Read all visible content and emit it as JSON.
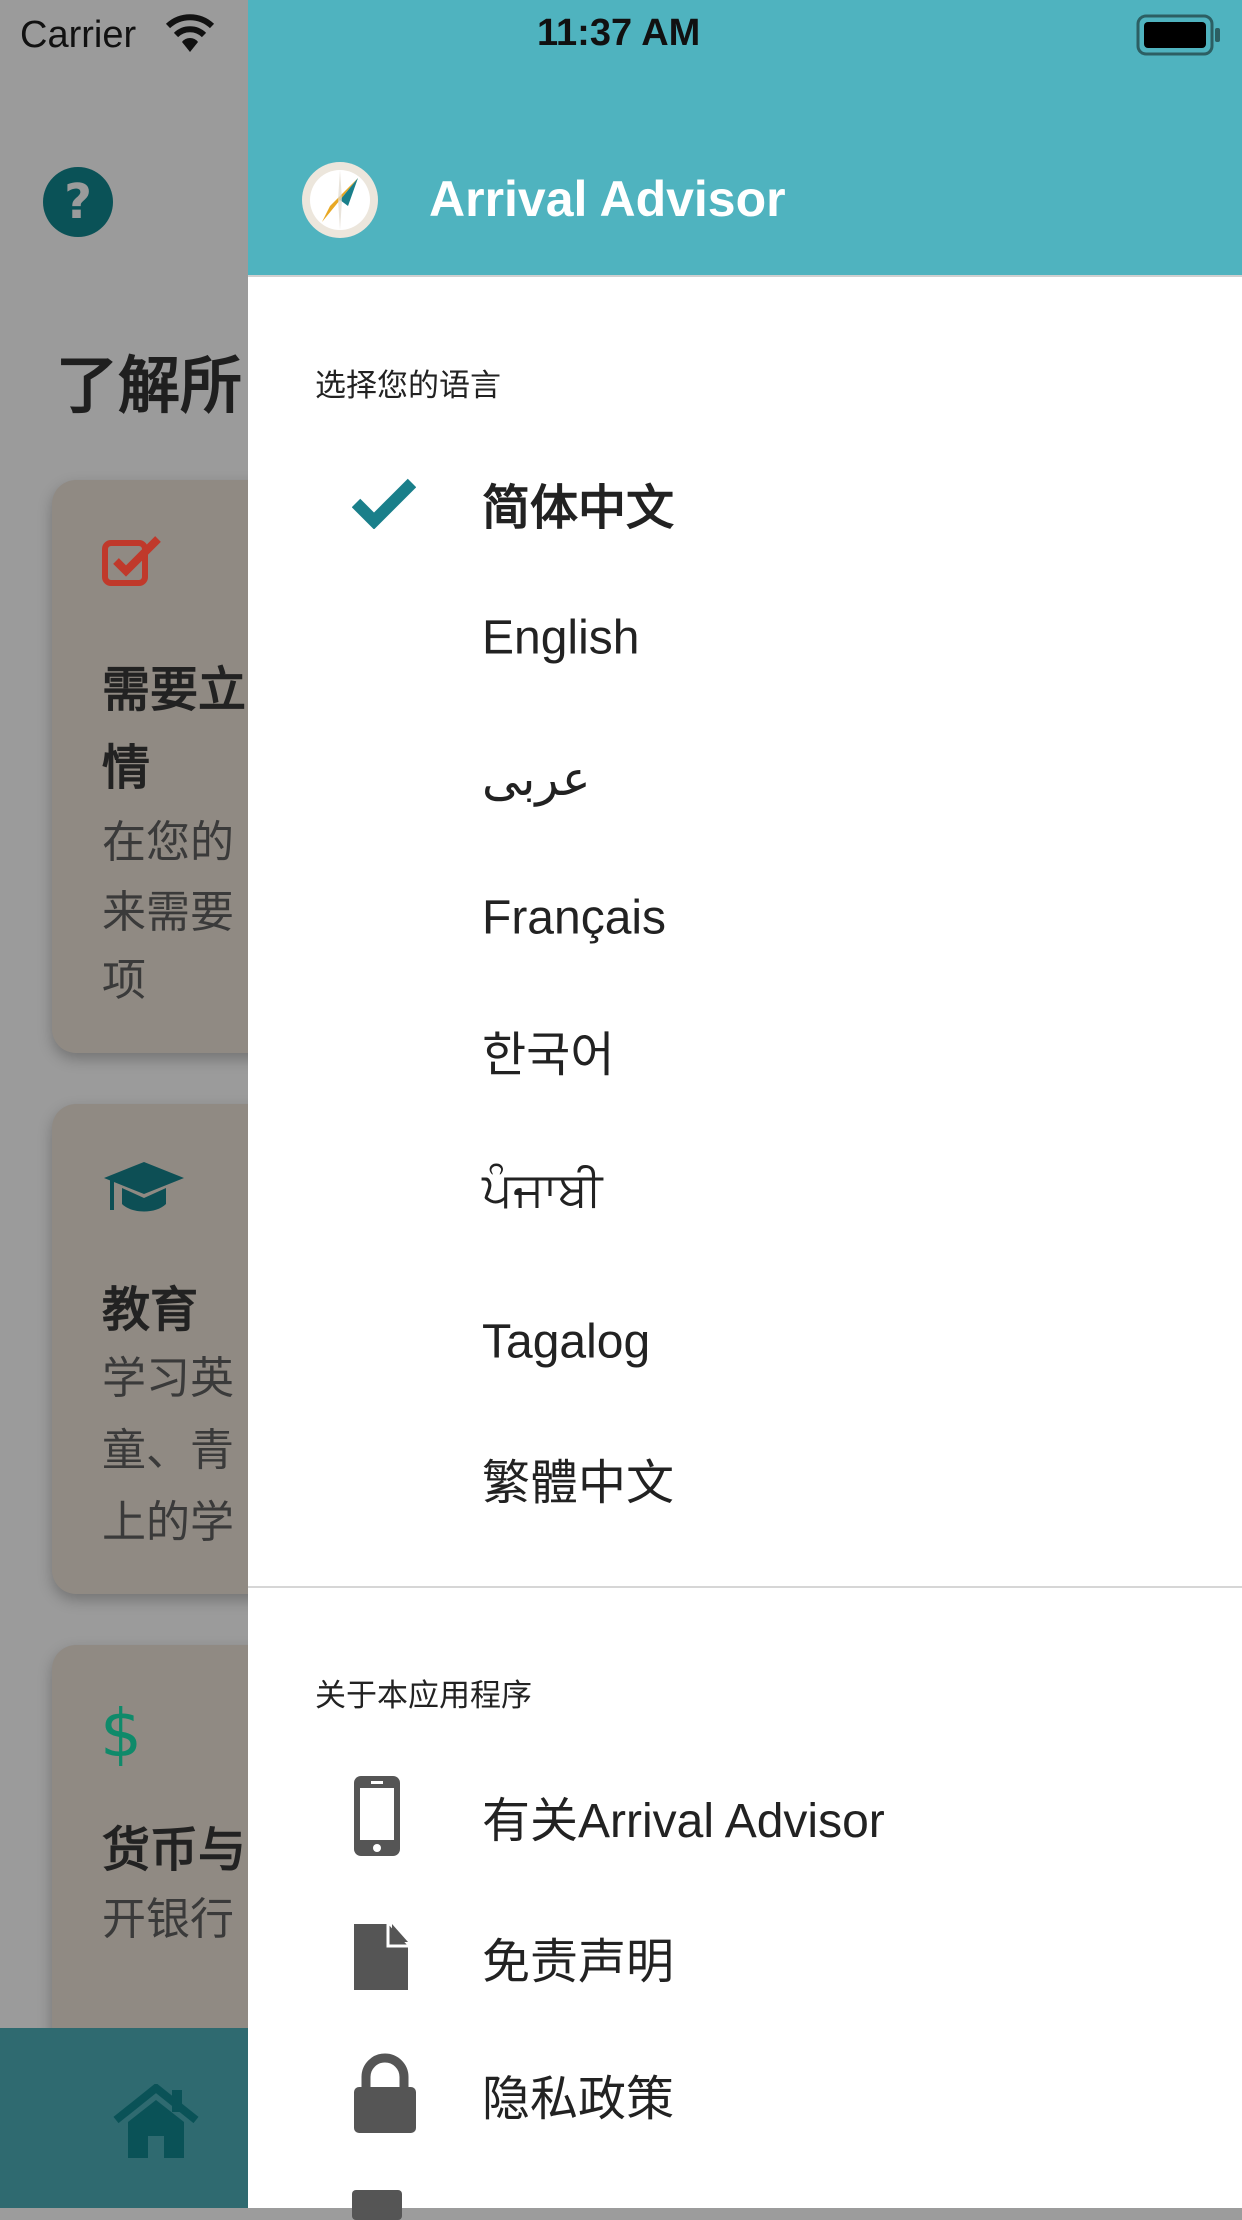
{
  "status_bar": {
    "carrier": "Carrier",
    "time": "11:37 AM"
  },
  "background": {
    "page_title": "了解所",
    "cards": [
      {
        "title_lines": [
          "需要立",
          "情"
        ],
        "desc_lines": [
          "在您的",
          "来需要",
          "项"
        ],
        "icon": "checkbox-icon",
        "icon_color": "#c0392b"
      },
      {
        "title_lines": [
          "教育"
        ],
        "desc_lines": [
          "学习英",
          "童、青",
          "上的学"
        ],
        "icon": "graduation-cap-icon",
        "icon_color": "#0d4f55"
      },
      {
        "title_lines": [
          "货币与"
        ],
        "desc_lines": [
          "开银行"
        ],
        "icon": "dollar-icon",
        "icon_color": "#0f8a6a"
      }
    ]
  },
  "drawer": {
    "title": "Arrival Advisor",
    "header_color": "#4fb3bf",
    "language_section": "选择您的语言",
    "languages": [
      {
        "label": "简体中文",
        "selected": true
      },
      {
        "label": "English",
        "selected": false
      },
      {
        "label": "عربى",
        "selected": false
      },
      {
        "label": "Français",
        "selected": false
      },
      {
        "label": "한국어",
        "selected": false
      },
      {
        "label": "ਪੰਜਾਬੀ",
        "selected": false
      },
      {
        "label": "Tagalog",
        "selected": false
      },
      {
        "label": "繁體中文",
        "selected": false
      }
    ],
    "about_section": "关于本应用程序",
    "about_items": [
      {
        "label": "有关Arrival Advisor",
        "icon": "phone-icon"
      },
      {
        "label": "免责声明",
        "icon": "document-icon"
      },
      {
        "label": "隐私政策",
        "icon": "lock-icon"
      }
    ]
  }
}
